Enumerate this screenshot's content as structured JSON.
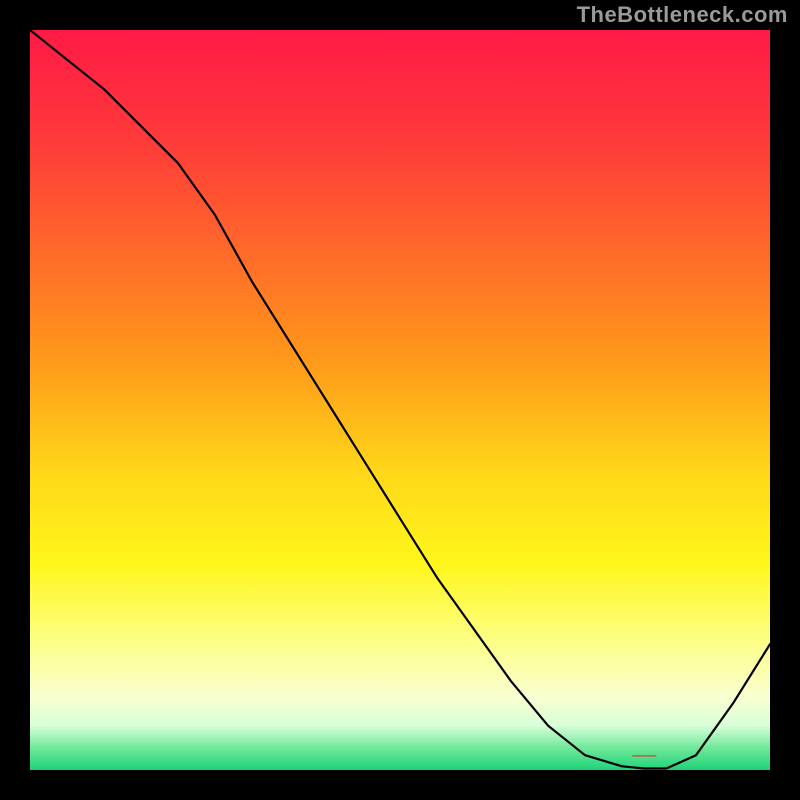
{
  "watermark": "TheBottleneck.com",
  "chart_data": {
    "type": "line",
    "title": "",
    "xlabel": "",
    "ylabel": "",
    "xlim": [
      0,
      100
    ],
    "ylim": [
      0,
      100
    ],
    "x": [
      0,
      5,
      10,
      15,
      20,
      25,
      30,
      35,
      40,
      45,
      50,
      55,
      60,
      65,
      70,
      75,
      80,
      83,
      86,
      90,
      95,
      100
    ],
    "values": [
      100,
      96,
      92,
      87,
      82,
      75,
      66,
      58,
      50,
      42,
      34,
      26,
      19,
      12,
      6,
      2,
      0.5,
      0.2,
      0.2,
      2,
      9,
      17
    ],
    "annotation": {
      "x": 83,
      "y": 1.5,
      "text": "——",
      "color": "#ff2a2a"
    },
    "background_gradient": {
      "stops": [
        {
          "offset": 0.0,
          "color": "#ff1a46"
        },
        {
          "offset": 0.15,
          "color": "#ff3a3a"
        },
        {
          "offset": 0.3,
          "color": "#ff6a2a"
        },
        {
          "offset": 0.45,
          "color": "#ff9a1a"
        },
        {
          "offset": 0.6,
          "color": "#ffd81a"
        },
        {
          "offset": 0.72,
          "color": "#fff61a"
        },
        {
          "offset": 0.82,
          "color": "#fdff80"
        },
        {
          "offset": 0.9,
          "color": "#faffd0"
        },
        {
          "offset": 0.94,
          "color": "#d8ffd8"
        },
        {
          "offset": 0.97,
          "color": "#70e89a"
        },
        {
          "offset": 1.0,
          "color": "#1fd37a"
        }
      ]
    }
  }
}
